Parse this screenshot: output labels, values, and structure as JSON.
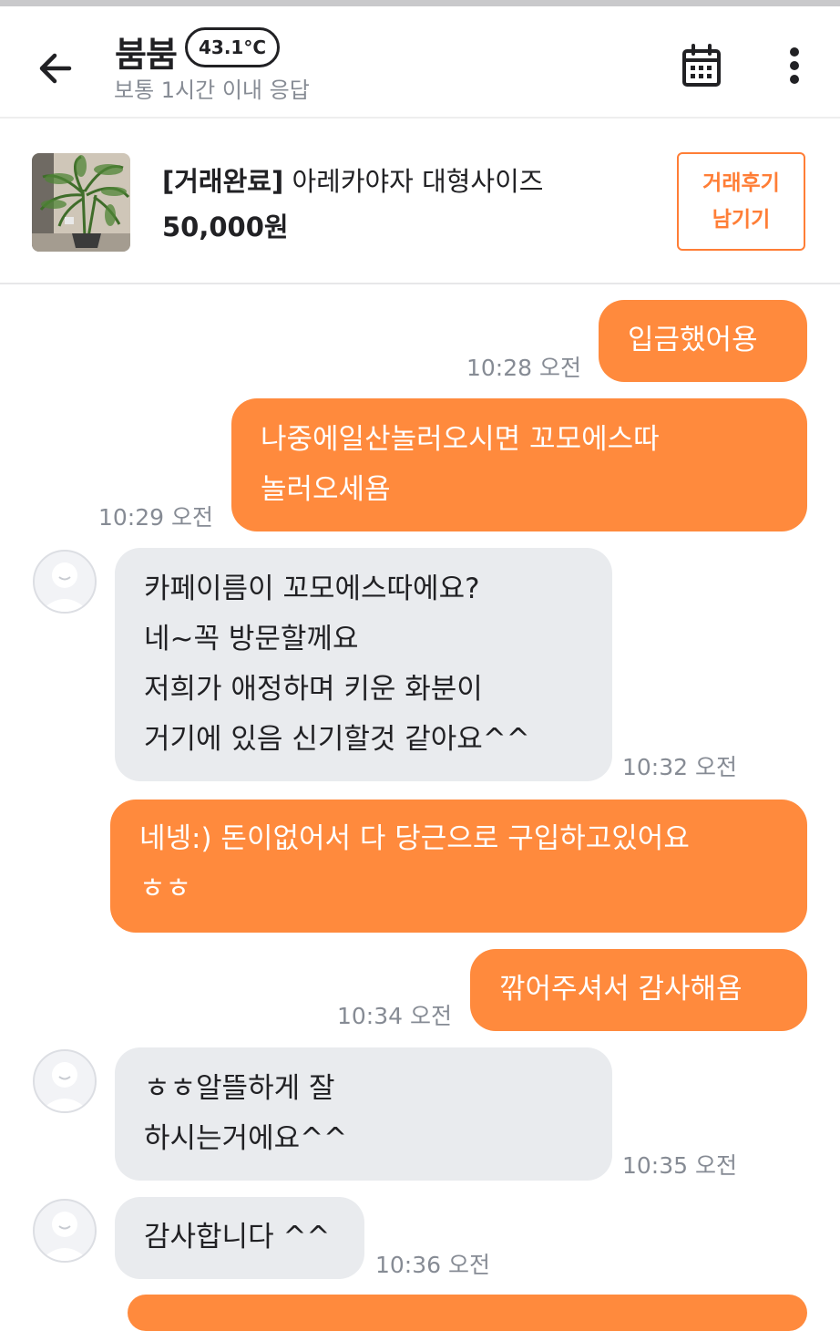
{
  "header": {
    "name": "붐붐",
    "temperature": "43.1°C",
    "response": "보통 1시간 이내 응답"
  },
  "product": {
    "status": "[거래완료]",
    "title": " 아레카야자 대형사이즈",
    "price": "50,000원",
    "review_button": "거래후기\n남기기"
  },
  "messages": [
    {
      "side": "out",
      "text": "입금했어용",
      "time": "10:28 오전"
    },
    {
      "side": "out",
      "text": "나중에일산놀러오시면 꼬모에스따\n놀러오세욤",
      "time": "10:29 오전"
    },
    {
      "side": "in",
      "text": "카페이름이 꼬모에스따에요?\n네~꼭 방문할께요\n저희가 애정하며 키운 화분이\n거기에 있음 신기할것 같아요^^",
      "time": "10:32 오전"
    },
    {
      "side": "out",
      "text": "네넹:) 돈이없어서 다 당근으로 구입하고있어요\nㅎㅎ",
      "time": ""
    },
    {
      "side": "out",
      "text": "깎어주셔서 감사해욤",
      "time": "10:34 오전"
    },
    {
      "side": "in",
      "text": "ㅎㅎ알뜰하게 잘\n하시는거에요^^",
      "time": "10:35 오전"
    },
    {
      "side": "in",
      "text": "감사합니다 ^^",
      "time": "10:36 오전"
    }
  ],
  "colors": {
    "accent": "#ff7e36",
    "outgoing_bubble": "#ff8a3d",
    "incoming_bubble": "#e9ebee"
  }
}
